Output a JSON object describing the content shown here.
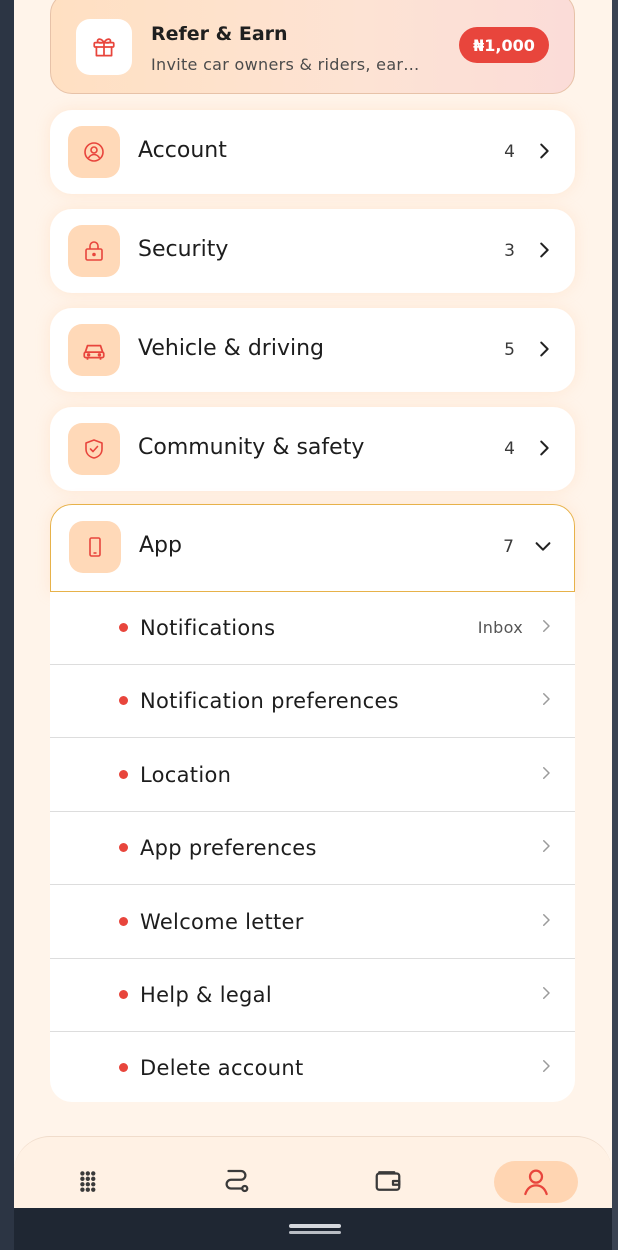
{
  "refer": {
    "title": "Refer & Earn",
    "subtitle": "Invite car owners & riders, ear…",
    "badge": "₦1,000",
    "icon": "gift-icon"
  },
  "menu": [
    {
      "label": "Account",
      "count": "4",
      "icon": "user-circle-icon"
    },
    {
      "label": "Security",
      "count": "3",
      "icon": "lock-icon"
    },
    {
      "label": "Vehicle & driving",
      "count": "5",
      "icon": "car-icon"
    },
    {
      "label": "Community & safety",
      "count": "4",
      "icon": "shield-check-icon"
    },
    {
      "label": "App",
      "count": "7",
      "icon": "phone-icon",
      "expanded": true
    }
  ],
  "app_items": [
    {
      "label": "Notifications",
      "aux": "Inbox"
    },
    {
      "label": "Notification preferences"
    },
    {
      "label": "Location"
    },
    {
      "label": "App preferences"
    },
    {
      "label": "Welcome letter"
    },
    {
      "label": "Help & legal"
    },
    {
      "label": "Delete account"
    }
  ],
  "bottom_nav": [
    {
      "icon": "grid-icon"
    },
    {
      "icon": "route-icon"
    },
    {
      "icon": "wallet-icon"
    },
    {
      "icon": "profile-icon",
      "active": true
    }
  ],
  "colors": {
    "accent": "#e8453c",
    "icon_bg": "#ffd9b8",
    "open_border": "#e7b24a",
    "background": "#fff4ea"
  }
}
